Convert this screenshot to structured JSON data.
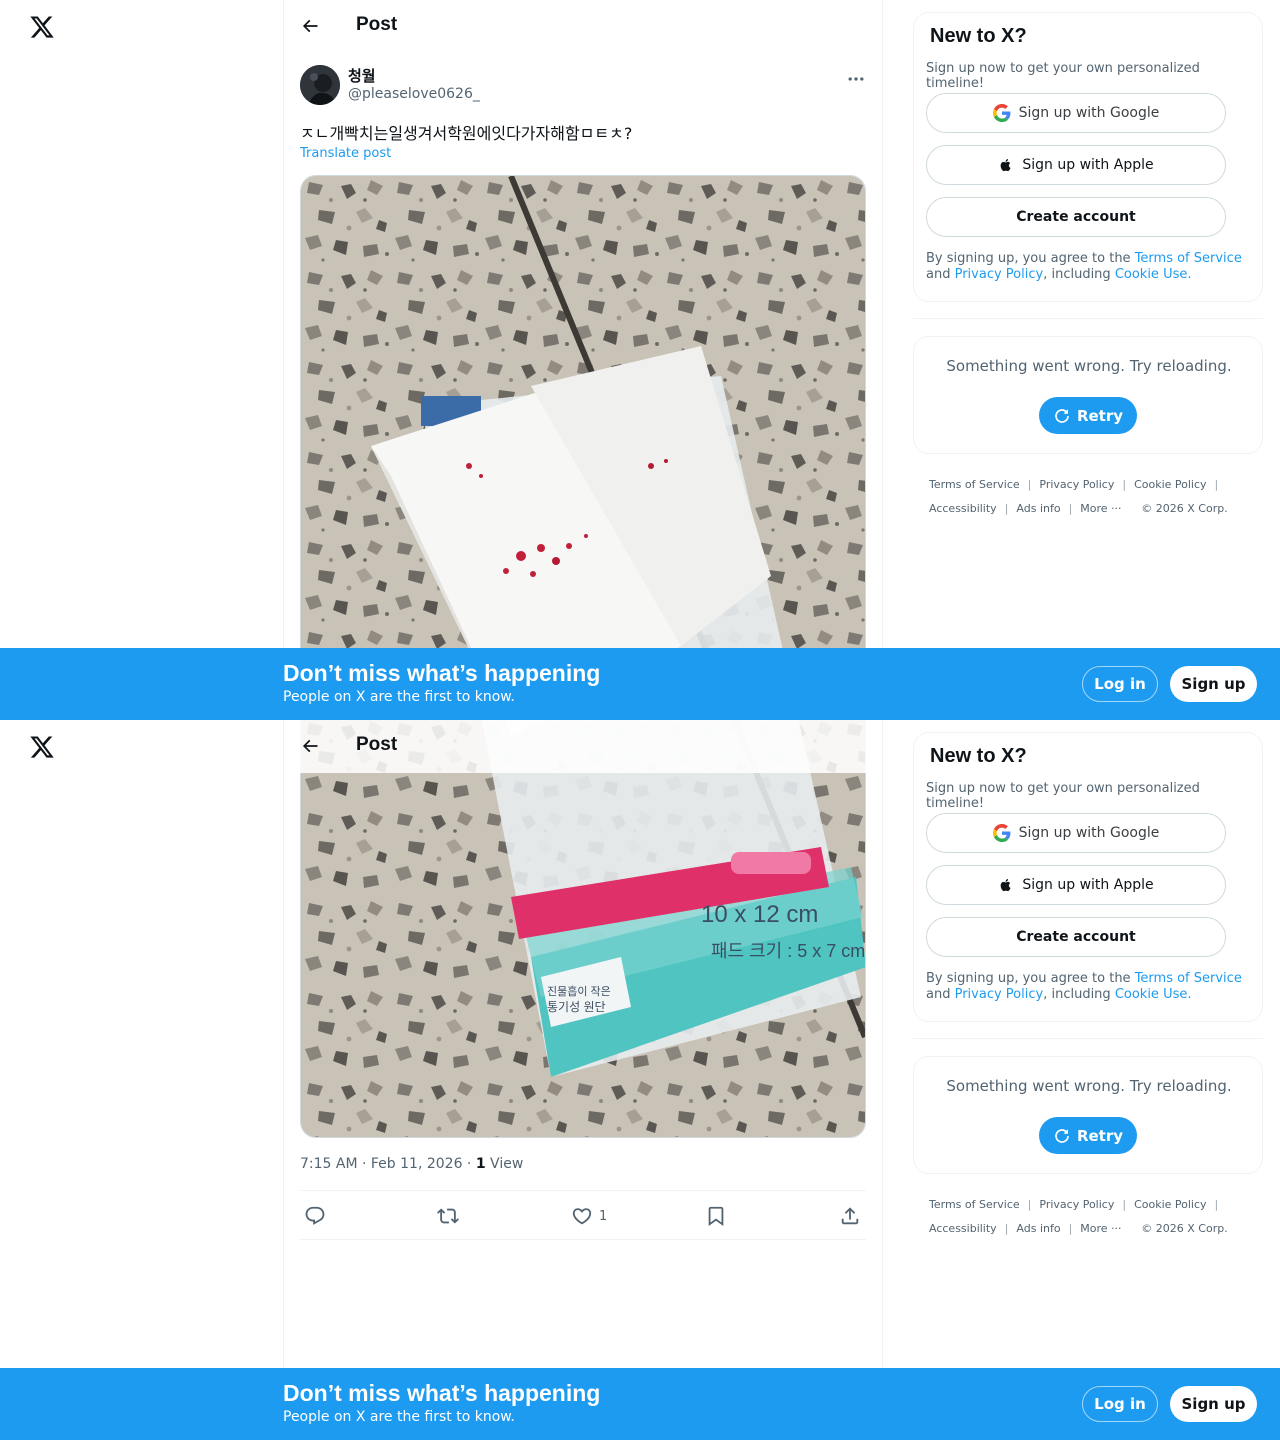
{
  "header": {
    "title": "Post"
  },
  "post": {
    "display_name": "청월",
    "handle": "@pleaselove0626_",
    "text": "ㅈㄴ개빡치는일생겨서학원에잇다가자해함ㅁㅌㅊ?",
    "translate_label": "Translate post",
    "time": "7:15 AM · Feb 11, 2026",
    "dot": " · ",
    "views_count": "1",
    "views_label": " View",
    "likes_count": "1"
  },
  "sidebar": {
    "title": "New to X?",
    "subtitle": "Sign up now to get your own personalized timeline!",
    "google_label": "Sign up with Google",
    "apple_label": "Sign up with Apple",
    "create_label": "Create account",
    "legal_prefix": "By signing up, you agree to the ",
    "terms_link": "Terms of Service",
    "legal_and": " and ",
    "privacy_link": "Privacy Policy",
    "legal_including": ", including ",
    "cookie_link": "Cookie Use.",
    "error_text": "Something went wrong. Try reloading.",
    "retry_label": "Retry"
  },
  "footer": {
    "terms": "Terms of Service",
    "privacy": "Privacy Policy",
    "cookie": "Cookie Policy",
    "accessibility": "Accessibility",
    "ads": "Ads info",
    "more": "More ···",
    "copyright": "© 2026 X Corp."
  },
  "banner": {
    "title": "Don’t miss what’s happening",
    "subtitle": "People on X are the first to know.",
    "login_label": "Log in",
    "signup_label": "Sign up"
  },
  "image_text": {
    "size": "10 x 12 cm",
    "pad": "패드 크기 : 5 x 7 cm",
    "badge_line1": "진물흡이 작은",
    "badge_line2": "통기성 원단"
  },
  "colors": {
    "brand_blue": "#1d9bf0",
    "text_primary": "#0f1419",
    "text_secondary": "#536471"
  }
}
